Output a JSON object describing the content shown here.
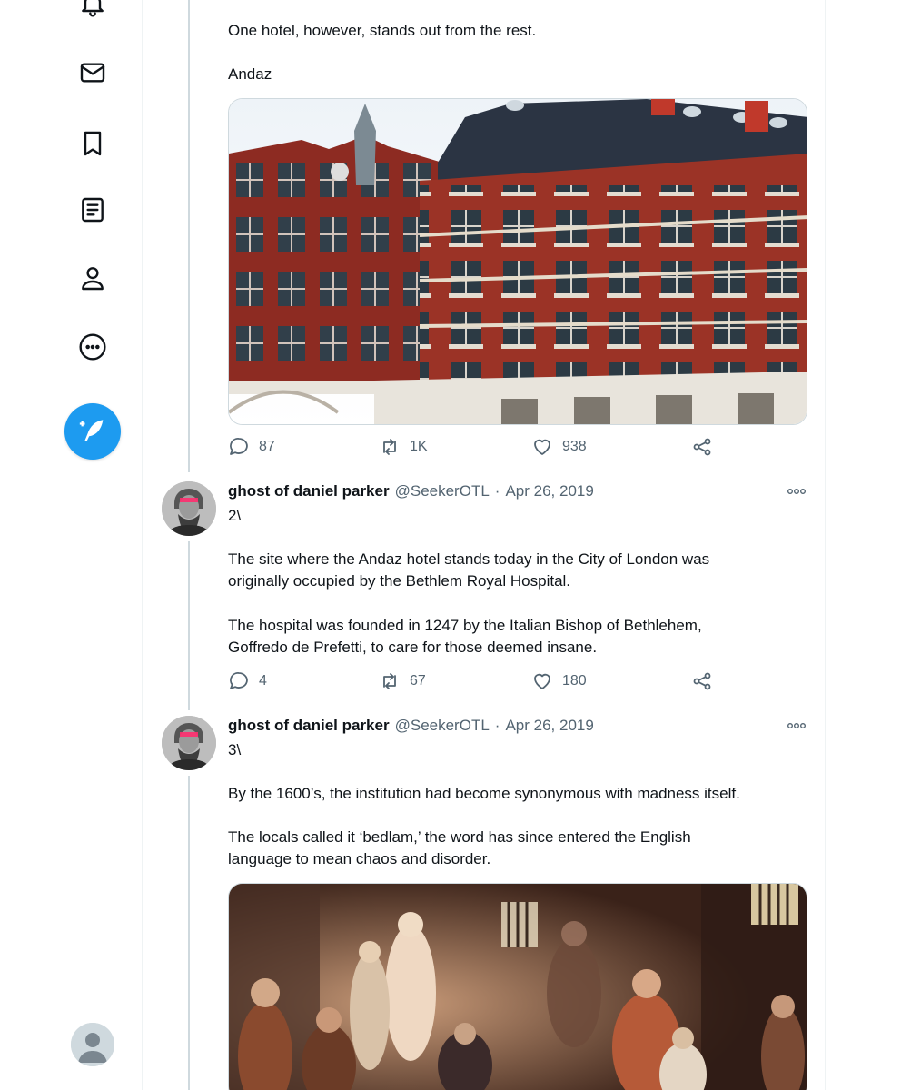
{
  "nav": {
    "icons": [
      "bell-icon",
      "mail-icon",
      "bookmark-icon",
      "lists-icon",
      "profile-icon",
      "more-circle-icon"
    ],
    "compose_icon": "compose-feather-icon",
    "accent": "#1d9bf0"
  },
  "thread": {
    "intro_lines": [
      "One hotel, however, stands out from the rest.",
      "Andaz"
    ],
    "first_media_alt": "Andaz hotel building",
    "first_actions": {
      "reply": "87",
      "retweet": "1K",
      "like": "938"
    },
    "tweets": [
      {
        "name": "ghost of daniel parker",
        "handle": "@SeekerOTL",
        "sep": "·",
        "date": "Apr 26, 2019",
        "lines": [
          "2\\",
          "",
          "The site where the Andaz hotel stands today in the City of London was",
          "originally occupied by the Bethlem Royal Hospital.",
          "",
          "The hospital was founded in 1247 by the Italian Bishop of Bethlehem,",
          "Goffredo de Prefetti, to care for those deemed insane."
        ],
        "actions": {
          "reply": "4",
          "retweet": "67",
          "like": "180"
        }
      },
      {
        "name": "ghost of daniel parker",
        "handle": "@SeekerOTL",
        "sep": "·",
        "date": "Apr 26, 2019",
        "lines": [
          "3\\",
          "",
          "By the 1600’s, the institution had become synonymous with madness itself.",
          "",
          "The locals called it ‘bedlam,’ the word has since entered the English",
          "language to mean chaos and disorder."
        ]
      }
    ]
  },
  "colors": {
    "text": "#0f1419",
    "muted": "#536471",
    "border": "#cfd9de"
  }
}
